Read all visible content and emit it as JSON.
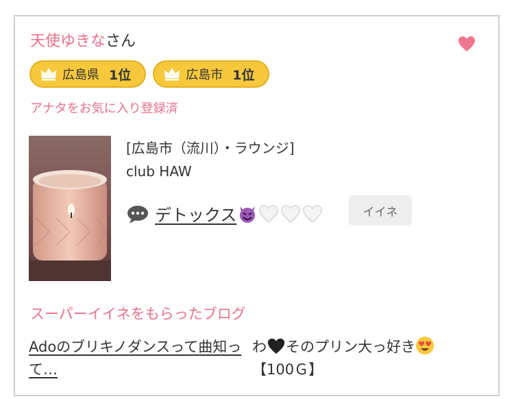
{
  "entry": {
    "user_name": "天使ゆきな",
    "user_suffix": "さん",
    "badges": [
      {
        "icon": "crown-icon",
        "label": "広島県",
        "rank": "1位"
      },
      {
        "icon": "crown-icon",
        "label": "広島市",
        "rank": "1位"
      }
    ],
    "favorite_status": "アナタをお気に入り登録済",
    "favorite_icon": "heart-icon",
    "shop_area": "[広島市（流川）・ラウンジ]",
    "shop_name": "club HAW",
    "blog_icon": "speech-bubble-icon",
    "blog_title": "デトックス",
    "blog_title_emoji": [
      "smiling-devil-icon",
      "white-heart-icon",
      "white-heart-icon",
      "white-heart-icon"
    ],
    "iine_label": "イイネ"
  },
  "super_iine": {
    "section_title": "スーパーイイネをもらったブログ",
    "blog_link": "Adoのブリキノダンスって曲知って…",
    "comment_prefix": "わ",
    "comment_emoji_1": "black-heart-icon",
    "comment_main": "そのプリン大っ好き",
    "comment_emoji_2": "heart-eyes-icon",
    "comment_amount": "【100Ｇ】"
  },
  "colors": {
    "accent_pink": "#e8708a",
    "badge_gold": "#f7c83c",
    "heart_pink": "#f07890",
    "border_gray": "#cfcfcf",
    "button_gray": "#eeeeee"
  }
}
